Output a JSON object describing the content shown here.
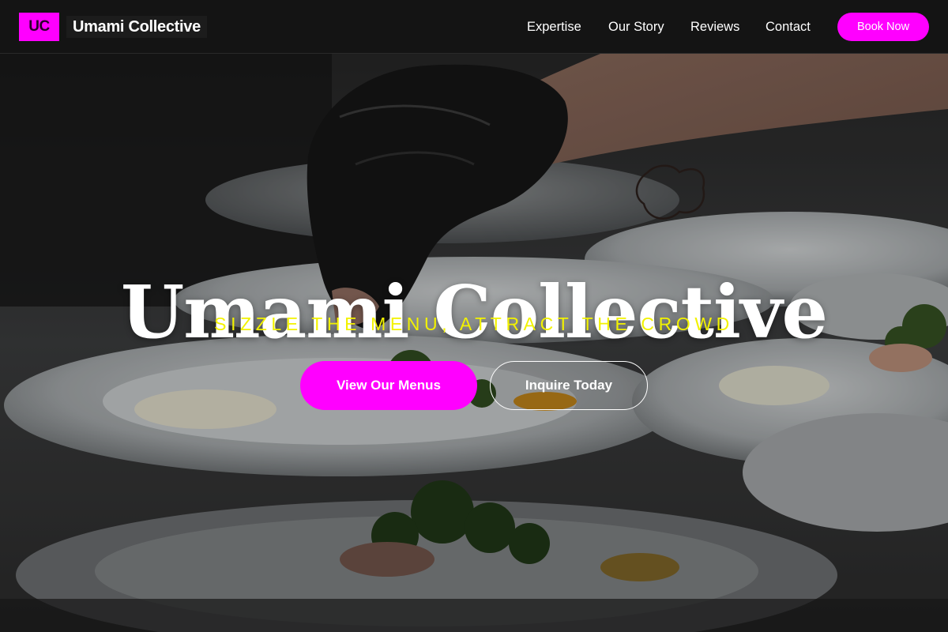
{
  "header": {
    "logo_initials": "UC",
    "brand_name": "Umami Collective",
    "nav": {
      "expertise": "Expertise",
      "our_story": "Our Story",
      "reviews": "Reviews",
      "contact": "Contact"
    },
    "book_button": "Book Now"
  },
  "hero": {
    "title": "Umami Collective",
    "tagline": "SIZZLE THE MENU, ATTRACT THE CROWD",
    "primary_button": "View Our Menus",
    "secondary_button": "Inquire Today"
  },
  "colors": {
    "accent": "#ff00ff",
    "tagline": "#f2f200",
    "nav_background": "#141414"
  }
}
